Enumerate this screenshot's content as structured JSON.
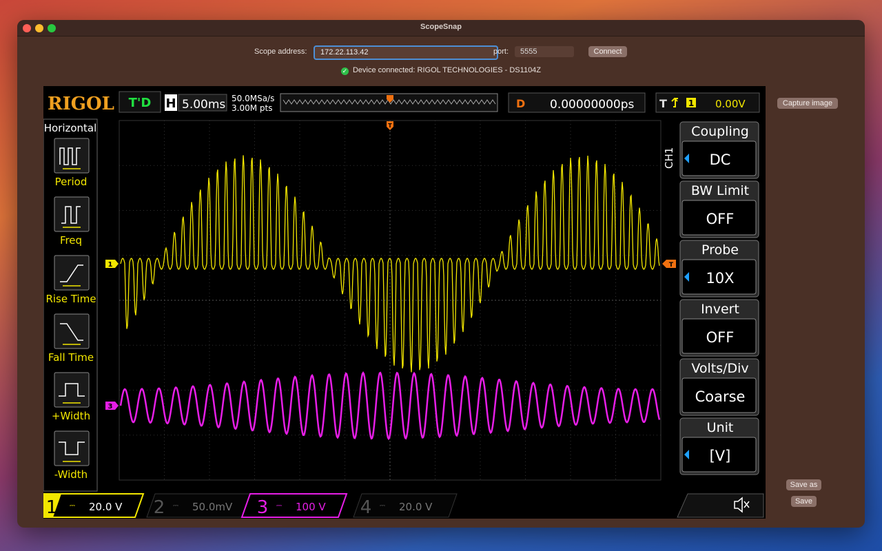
{
  "window": {
    "title": "ScopeSnap"
  },
  "connection": {
    "address_label": "Scope address:",
    "address_value": "172.22.113.42",
    "port_label": "port:",
    "port_value": "5555",
    "connect_label": "Connect",
    "status_text": "Device connected: RIGOL TECHNOLOGIES - DS1104Z"
  },
  "actions": {
    "capture_label": "Capture image",
    "save_as_label": "Save as",
    "save_label": "Save"
  },
  "scope": {
    "brand": "RIGOL",
    "run_state": "T'D",
    "h_label": "H",
    "timebase": "5.00ms",
    "sample_rate": "50.0MSa/s",
    "memory_depth": "3.00M pts",
    "d_label": "D",
    "delay": "0.00000000ps",
    "t_label": "T",
    "trigger_channel": "1",
    "trigger_level": "0.00V",
    "left_menu": {
      "title": "Horizontal",
      "items": [
        "Period",
        "Freq",
        "Rise Time",
        "Fall Time",
        "+Width",
        "-Width"
      ]
    },
    "right_menu": {
      "channel": "CH1",
      "items": [
        {
          "label": "Coupling",
          "value": "DC"
        },
        {
          "label": "BW Limit",
          "value": "OFF"
        },
        {
          "label": "Probe",
          "value": "10X"
        },
        {
          "label": "Invert",
          "value": "OFF"
        },
        {
          "label": "Volts/Div",
          "value": "Coarse"
        },
        {
          "label": "Unit",
          "value": "[V]"
        }
      ]
    },
    "channels": [
      {
        "num": "1",
        "scale": "20.0 V",
        "color": "#f2e600",
        "active": true
      },
      {
        "num": "2",
        "scale": "50.0mV",
        "color": "#2a9db0",
        "active": false
      },
      {
        "num": "3",
        "scale": "100 V",
        "color": "#e61ee6",
        "active": true
      },
      {
        "num": "4",
        "scale": "20.0 V",
        "color": "#3a5fcd",
        "active": false
      }
    ],
    "ch1_marker": "1",
    "ch3_marker": "3",
    "trigger_marker": "T"
  }
}
